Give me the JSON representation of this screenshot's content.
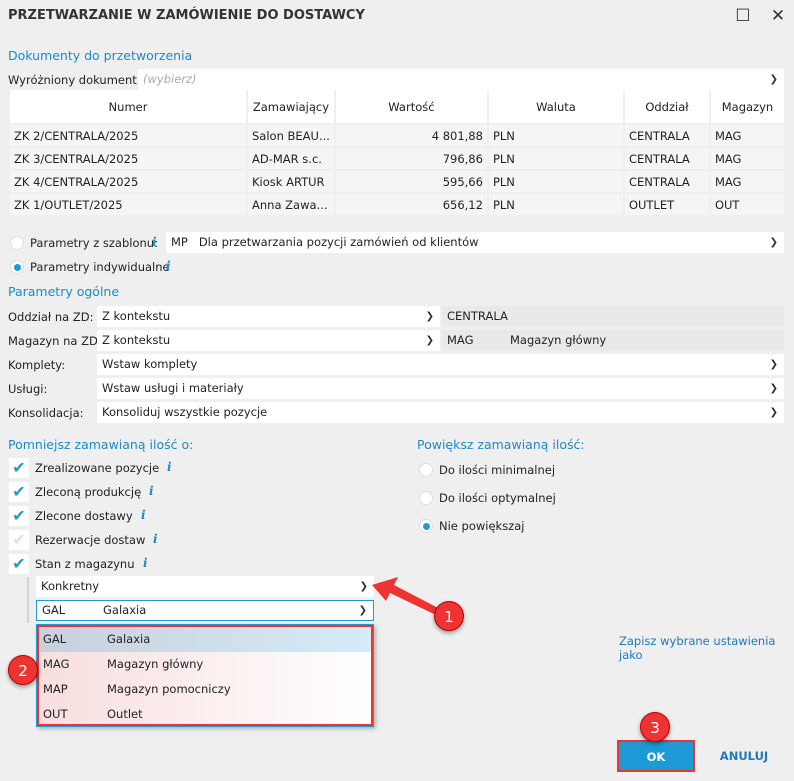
{
  "window": {
    "title": "PRZETWARZANIE W ZAMÓWIENIE DO DOSTAWCY",
    "maximize": "☐",
    "close": "✕"
  },
  "documents": {
    "heading": "Dokumenty do przetworzenia",
    "highlight_label": "Wyróżniony dokument:",
    "highlight_placeholder": "(wybierz)",
    "columns": [
      "Numer",
      "Zamawiający",
      "Wartość",
      "Waluta",
      "Oddział",
      "Magazyn"
    ],
    "rows": [
      [
        "ZK 2/CENTRALA/2025",
        "Salon BEAU...",
        "4 801,88",
        "PLN",
        "CENTRALA",
        "MAG"
      ],
      [
        "ZK 3/CENTRALA/2025",
        "AD-MAR s.c.",
        "796,86",
        "PLN",
        "CENTRALA",
        "MAG"
      ],
      [
        "ZK 4/CENTRALA/2025",
        "Kiosk ARTUR",
        "595,66",
        "PLN",
        "CENTRALA",
        "MAG"
      ],
      [
        "ZK 1/OUTLET/2025",
        "Anna Zawa...",
        "656,12",
        "PLN",
        "OUTLET",
        "OUT"
      ]
    ]
  },
  "params": {
    "template_label": "Parametry z szablonu:",
    "template_code": "MP",
    "template_name": "Dla przetwarzania pozycji zamówień od klientów",
    "individual_label": "Parametry indywidualne",
    "info": "i"
  },
  "general": {
    "heading": "Parametry ogólne",
    "oddzial_label": "Oddział na ZD:",
    "oddzial_value": "Z kontekstu",
    "oddzial_result": "CENTRALA",
    "magazyn_label": "Magazyn na ZD:",
    "magazyn_value": "Z kontekstu",
    "magazyn_code": "MAG",
    "magazyn_name": "Magazyn główny",
    "komplety_label": "Komplety:",
    "komplety_value": "Wstaw komplety",
    "uslugi_label": "Usługi:",
    "uslugi_value": "Wstaw usługi i materiały",
    "konsolidacja_label": "Konsolidacja:",
    "konsolidacja_value": "Konsoliduj wszystkie pozycje"
  },
  "reduce": {
    "heading": "Pomniejsz zamawianą ilość o:",
    "items": [
      {
        "label": "Zrealizowane pozycje",
        "checked": true
      },
      {
        "label": "Zleconą produkcję",
        "checked": true
      },
      {
        "label": "Zlecone dostawy",
        "checked": true
      },
      {
        "label": "Rezerwacje dostaw",
        "checked": false
      },
      {
        "label": "Stan z magazynu",
        "checked": true
      }
    ],
    "mode_value": "Konkretny",
    "wh_code": "GAL",
    "wh_name": "Galaxia",
    "options": [
      [
        "GAL",
        "Galaxia"
      ],
      [
        "MAG",
        "Magazyn główny"
      ],
      [
        "MAP",
        "Magazyn pomocniczy"
      ],
      [
        "OUT",
        "Outlet"
      ]
    ]
  },
  "increase": {
    "heading": "Powiększ zamawianą ilość:",
    "options": [
      "Do ilości minimalnej",
      "Do ilości optymalnej",
      "Nie powiększaj"
    ],
    "selected": 2
  },
  "save_link": "Zapisz wybrane ustawienia jako",
  "buttons": {
    "ok": "OK",
    "cancel": "ANULUJ"
  },
  "annotations": [
    "1",
    "2",
    "3"
  ],
  "colors": {
    "accent": "#1d8ac6",
    "annotation": "#e33333"
  }
}
